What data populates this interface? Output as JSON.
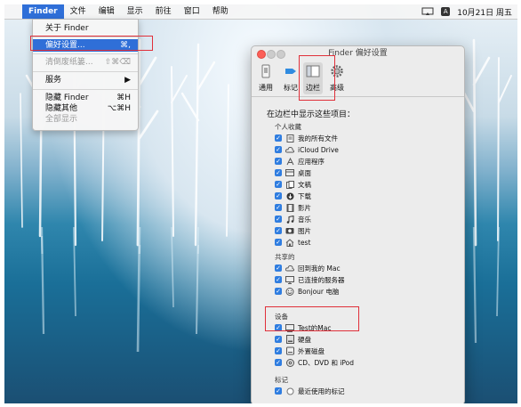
{
  "menubar": {
    "app": "Finder",
    "items": [
      "文件",
      "编辑",
      "显示",
      "前往",
      "窗口",
      "帮助"
    ],
    "clock": "10月21日 周五",
    "a_badge": "A"
  },
  "finder_menu": {
    "about": "关于 Finder",
    "prefs": "偏好设置...",
    "prefs_shortcut": "⌘,",
    "empty_trash": "清倒废纸篓...",
    "empty_trash_shortcut": "⇧⌘⌫",
    "services": "服务",
    "services_arrow": "▶",
    "hide_finder": "隐藏 Finder",
    "hide_finder_shortcut": "⌘H",
    "hide_others": "隐藏其他",
    "hide_others_shortcut": "⌥⌘H",
    "show_all": "全部显示"
  },
  "prefs_window": {
    "title": "Finder 偏好设置",
    "tabs": [
      "通用",
      "标记",
      "边栏",
      "高级"
    ],
    "heading": "在边栏中显示这些项目：",
    "sections": [
      {
        "title": "个人收藏",
        "items": [
          {
            "label": "我的所有文件",
            "icon": "all-files-icon"
          },
          {
            "label": "iCloud Drive",
            "icon": "cloud-icon"
          },
          {
            "label": "应用程序",
            "icon": "applications-icon"
          },
          {
            "label": "桌面",
            "icon": "desktop-icon"
          },
          {
            "label": "文稿",
            "icon": "documents-icon"
          },
          {
            "label": "下载",
            "icon": "downloads-icon"
          },
          {
            "label": "影片",
            "icon": "movies-icon"
          },
          {
            "label": "音乐",
            "icon": "music-icon"
          },
          {
            "label": "图片",
            "icon": "pictures-icon"
          },
          {
            "label": "test",
            "icon": "home-icon"
          }
        ]
      },
      {
        "title": "共享的",
        "items": [
          {
            "label": "回到我的 Mac",
            "icon": "cloud-icon"
          },
          {
            "label": "已连接的服务器",
            "icon": "server-icon"
          },
          {
            "label": "Bonjour 电脑",
            "icon": "bonjour-icon"
          }
        ]
      },
      {
        "title": "设备",
        "items": [
          {
            "label": "Test的Mac",
            "icon": "computer-icon"
          },
          {
            "label": "硬盘",
            "icon": "hard-disk-icon"
          },
          {
            "label": "外置磁盘",
            "icon": "external-disk-icon"
          },
          {
            "label": "CD、DVD 和 iPod",
            "icon": "cd-icon"
          }
        ]
      },
      {
        "title": "标记",
        "items": [
          {
            "label": "最近使用的标记",
            "icon": "tag-icon"
          }
        ]
      }
    ]
  },
  "colors": {
    "highlight": "#2f6fd8",
    "checkbox": "#2f7de0",
    "annotation": "#e0303a"
  }
}
